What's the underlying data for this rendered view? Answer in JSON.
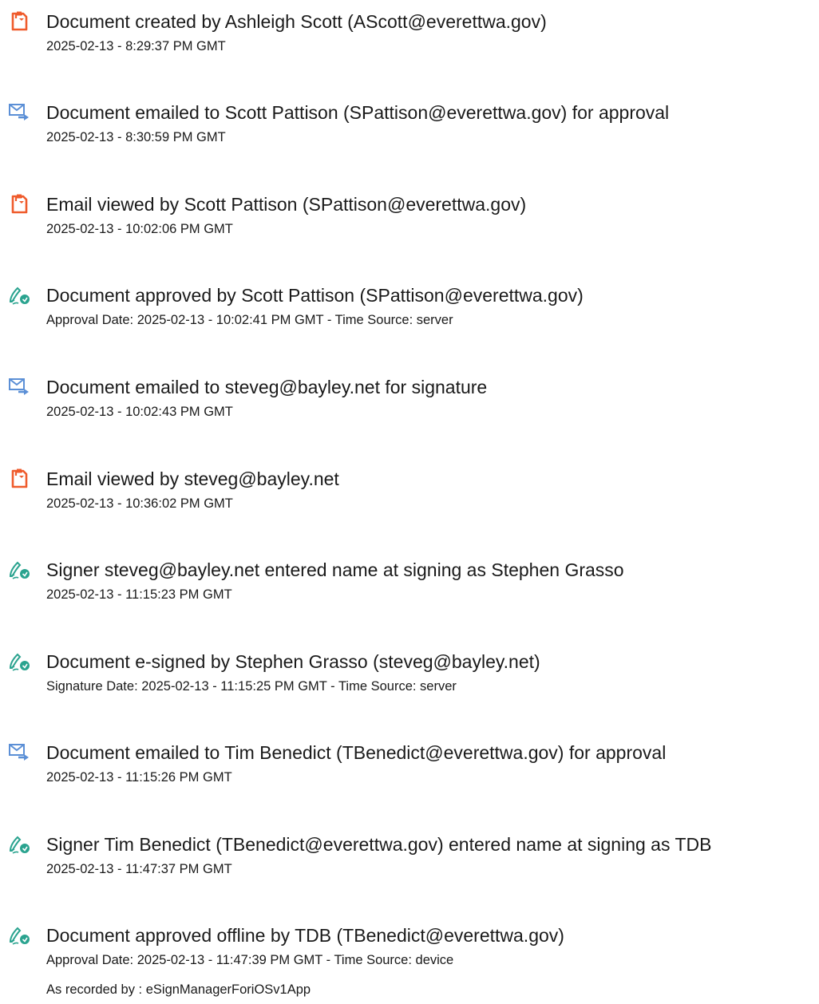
{
  "icon_colors": {
    "document": "#ef5b2c",
    "email": "#5b8fd6",
    "sign": "#2aa38f"
  },
  "entries": [
    {
      "icon": "document-icon",
      "title": "Document created by Ashleigh Scott (AScott@everettwa.gov)",
      "lines": [
        "2025-02-13 - 8:29:37 PM GMT"
      ]
    },
    {
      "icon": "email-icon",
      "title": "Document emailed to Scott Pattison (SPattison@everettwa.gov) for approval",
      "lines": [
        "2025-02-13 - 8:30:59 PM GMT"
      ]
    },
    {
      "icon": "document-icon",
      "title": "Email viewed by Scott Pattison (SPattison@everettwa.gov)",
      "lines": [
        "2025-02-13 - 10:02:06 PM GMT"
      ]
    },
    {
      "icon": "signature-pen-icon",
      "title": "Document approved by Scott Pattison (SPattison@everettwa.gov)",
      "lines": [
        "Approval Date: 2025-02-13 - 10:02:41 PM GMT - Time Source: server"
      ]
    },
    {
      "icon": "email-icon",
      "title": "Document emailed to steveg@bayley.net for signature",
      "lines": [
        "2025-02-13 - 10:02:43 PM GMT"
      ]
    },
    {
      "icon": "document-icon",
      "title": "Email viewed by steveg@bayley.net",
      "lines": [
        "2025-02-13 - 10:36:02 PM GMT"
      ]
    },
    {
      "icon": "signature-pen-icon",
      "title": "Signer steveg@bayley.net entered name at signing as Stephen Grasso",
      "lines": [
        "2025-02-13 - 11:15:23 PM GMT"
      ]
    },
    {
      "icon": "signature-pen-icon",
      "title": "Document e-signed by Stephen Grasso (steveg@bayley.net)",
      "lines": [
        "Signature Date: 2025-02-13 - 11:15:25 PM GMT - Time Source: server"
      ]
    },
    {
      "icon": "email-icon",
      "title": "Document emailed to Tim Benedict (TBenedict@everettwa.gov) for approval",
      "lines": [
        "2025-02-13 - 11:15:26 PM GMT"
      ]
    },
    {
      "icon": "signature-pen-icon",
      "title": "Signer Tim Benedict (TBenedict@everettwa.gov) entered name at signing as TDB",
      "lines": [
        "2025-02-13 - 11:47:37 PM GMT"
      ]
    },
    {
      "icon": "signature-pen-icon",
      "title": "Document approved offline by TDB (TBenedict@everettwa.gov)",
      "lines": [
        "Approval Date: 2025-02-13 - 11:47:39 PM GMT - Time Source: device",
        "As recorded by : eSignManagerForiOSv1App"
      ]
    }
  ]
}
